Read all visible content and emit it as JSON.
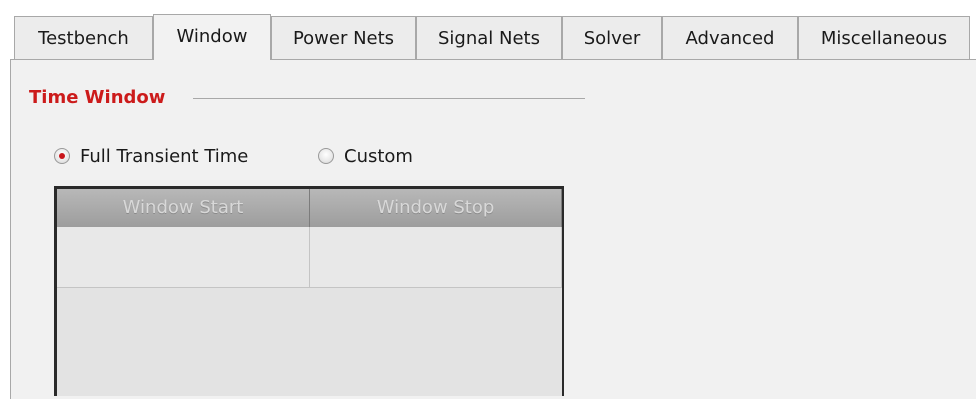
{
  "tabs": [
    {
      "label": "Testbench",
      "active": false
    },
    {
      "label": "Window",
      "active": true
    },
    {
      "label": "Power Nets",
      "active": false
    },
    {
      "label": "Signal Nets",
      "active": false
    },
    {
      "label": "Solver",
      "active": false
    },
    {
      "label": "Advanced",
      "active": false
    },
    {
      "label": "Miscellaneous",
      "active": false
    }
  ],
  "time_window": {
    "title": "Time Window",
    "options": [
      {
        "label": "Full Transient Time",
        "selected": true
      },
      {
        "label": "Custom",
        "selected": false
      }
    ],
    "table": {
      "columns": [
        "Window Start",
        "Window Stop"
      ],
      "rows": [
        [
          "",
          ""
        ]
      ]
    }
  },
  "colors": {
    "accent": "#cc1b1b",
    "radio_checked": "#c8141a",
    "panel_bg": "#f1f1f1"
  }
}
